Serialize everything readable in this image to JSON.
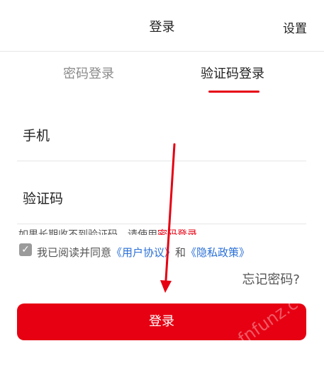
{
  "header": {
    "title": "登录",
    "settings": "设置"
  },
  "tabs": [
    {
      "label": "密码登录",
      "active": false
    },
    {
      "label": "验证码登录",
      "active": true
    }
  ],
  "form": {
    "phone_label": "手机",
    "code_label": "验证码",
    "hint_prefix": "如果长期收不到验证码，请使用",
    "hint_link": "密码登录"
  },
  "agreement": {
    "checked": true,
    "prefix": "我已阅读并同意",
    "user_agreement": "《用户协议》",
    "and": "和",
    "privacy_policy": "《隐私政策》"
  },
  "forgot_password": "忘记密码?",
  "login_button": "登录",
  "watermark": "fnfunz.c",
  "colors": {
    "accent": "#e60012",
    "link": "#2a6fd6"
  }
}
